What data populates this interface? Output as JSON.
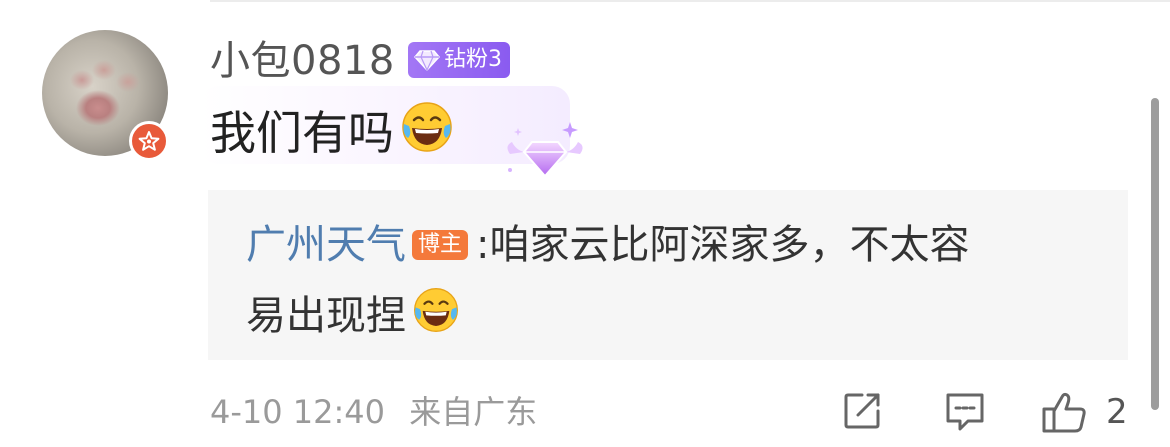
{
  "comment": {
    "username": "小包0818",
    "badge": {
      "label": "钻粉3",
      "color": "#9466f3"
    },
    "text": "我们有吗",
    "text_emoji": "laughing-crying-emoji"
  },
  "reply": {
    "author": "广州天气",
    "author_tag": "博主",
    "separator": ":",
    "line1": "咱家云比阿深家多，不太容",
    "line2": "易出现捏",
    "emoji": "laughing-crying-emoji"
  },
  "meta": {
    "time": "4-10 12:40",
    "location": "来自广东"
  },
  "actions": {
    "share_icon": "share-icon",
    "comment_icon": "comment-icon",
    "like_icon": "thumbs-up-icon",
    "like_count": "2"
  },
  "colors": {
    "author_link": "#507daf",
    "blogger_tag": "#f4793b",
    "badge_purple": "#9466f3",
    "vip_badge": "#e85a3a"
  }
}
